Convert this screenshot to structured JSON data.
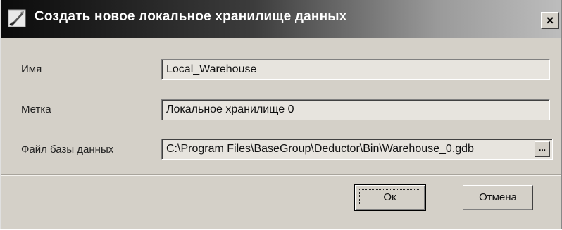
{
  "dialog": {
    "title": "Создать новое локальное хранилище данных",
    "close_label": "×"
  },
  "form": {
    "name_label": "Имя",
    "name_value": "Local_Warehouse",
    "tag_label": "Метка",
    "tag_value": "Локальное хранилище 0",
    "db_file_label": "Файл базы данных",
    "db_file_value": "C:\\Program Files\\BaseGroup\\Deductor\\Bin\\Warehouse_0.gdb",
    "browse_label": "..."
  },
  "buttons": {
    "ok_label": "Ок",
    "cancel_label": "Отмена"
  },
  "icons": {
    "app_icon": "brush-icon"
  }
}
